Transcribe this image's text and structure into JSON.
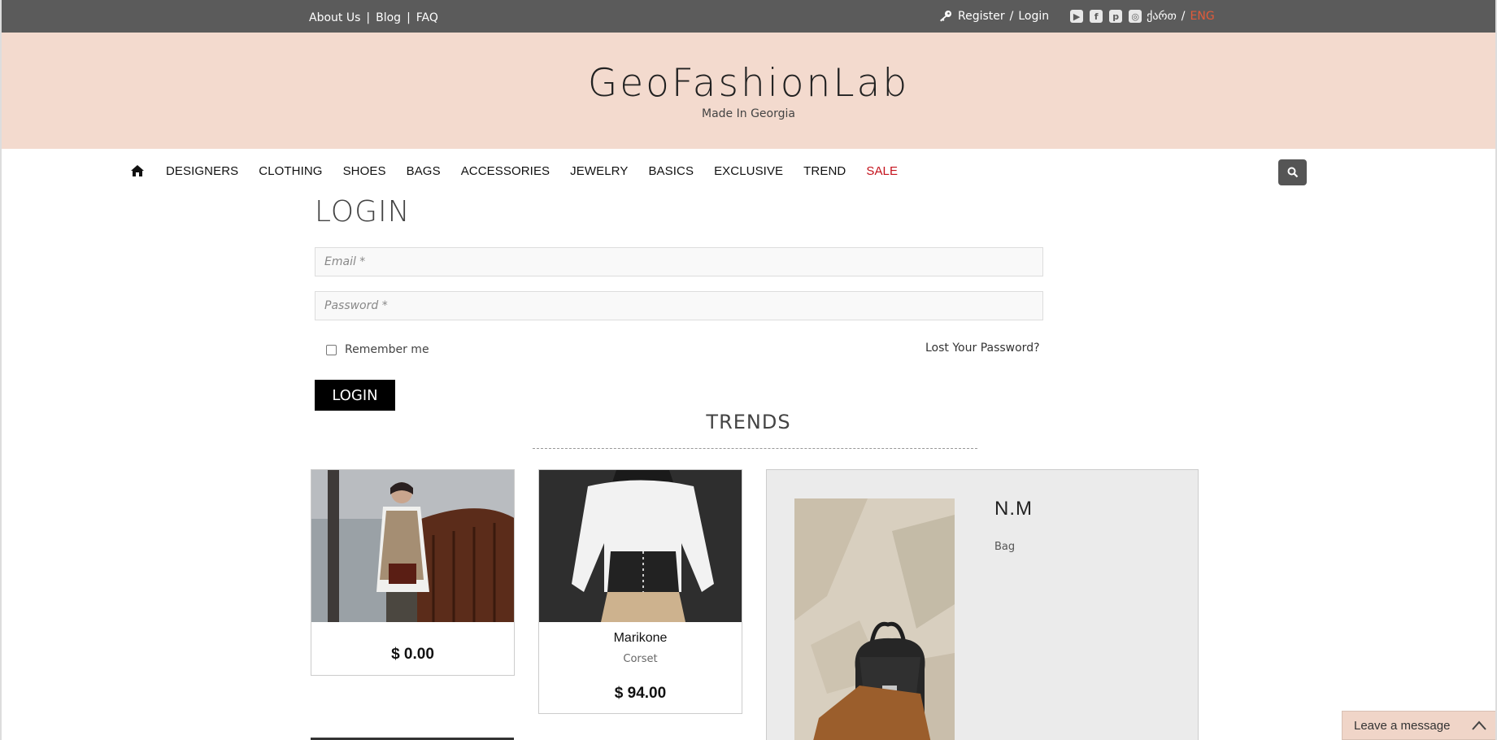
{
  "topbar": {
    "links": [
      {
        "label": "About Us"
      },
      {
        "label": "Blog"
      },
      {
        "label": "FAQ"
      }
    ],
    "separator": "|",
    "auth": {
      "register": "Register",
      "slash": "/",
      "login": "Login"
    },
    "social_icons": [
      "youtube-icon",
      "facebook-icon",
      "pinterest-icon",
      "instagram-icon"
    ],
    "lang": {
      "georgian": "ქართ",
      "slash": "/",
      "english": "ENG"
    }
  },
  "header": {
    "brand": "GeoFashionLab",
    "tagline": "Made In Georgia"
  },
  "nav": {
    "home_icon": "home-icon",
    "items": [
      "DESIGNERS",
      "CLOTHING",
      "SHOES",
      "BAGS",
      "ACCESSORIES",
      "JEWELRY",
      "BASICS",
      "EXCLUSIVE",
      "TREND"
    ],
    "sale": "SALE",
    "search_icon": "search-icon"
  },
  "login": {
    "title": "LOGIN",
    "email_placeholder": "Email *",
    "password_placeholder": "Password *",
    "remember": "Remember me",
    "lost_password": "Lost Your Password?",
    "button": "LOGIN"
  },
  "trends": {
    "title": "TRENDS",
    "products": [
      {
        "name": "",
        "type": "",
        "price": "$ 0.00"
      },
      {
        "name": "Marikone",
        "type": "Corset",
        "price": "$ 94.00"
      }
    ],
    "feature": {
      "name": "N.M",
      "type": "Bag"
    }
  },
  "chat": {
    "label": "Leave a message"
  },
  "colors": {
    "accent": "#e25b3a",
    "sale": "#c4111b",
    "header_bg": "#f3dace",
    "topbar_bg": "#5b5b5b"
  }
}
